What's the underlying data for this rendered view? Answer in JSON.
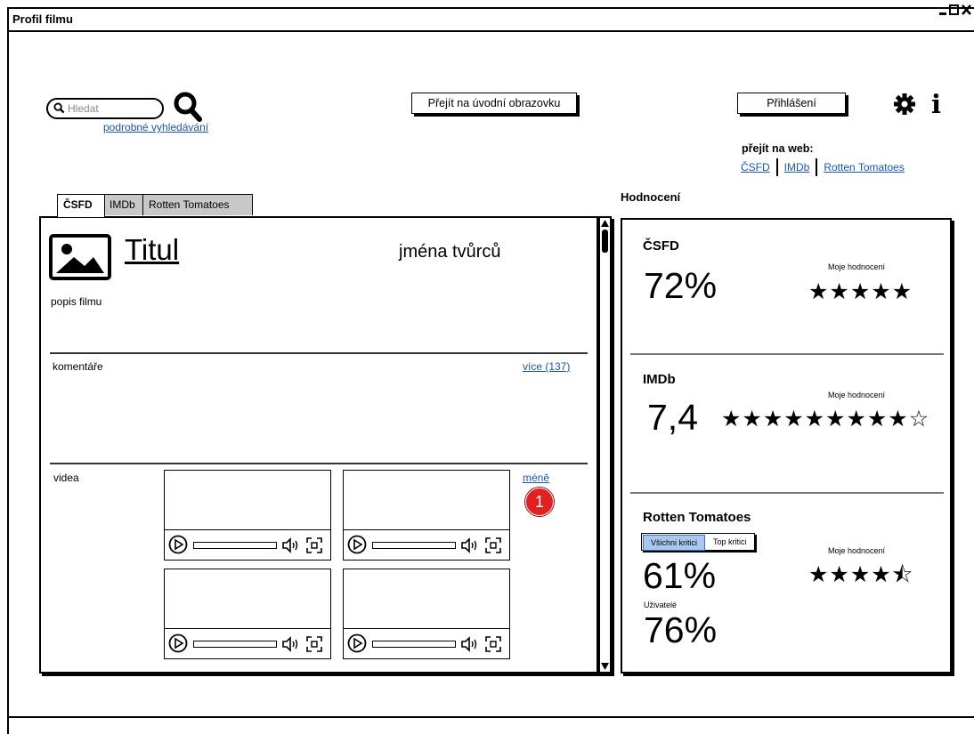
{
  "window": {
    "title": "Profil filmu",
    "controls": "– □ ✕",
    "corner_mark": "↘"
  },
  "header": {
    "search_placeholder": "Hledat",
    "advanced_search": "podrobné vyhledávání",
    "home_button": "Přejít na úvodní obrazovku",
    "login_button": "Přihlášení",
    "web_label": "přejít na web:",
    "web_links": [
      "ČSFD",
      "IMDb",
      "Rotten Tomatoes"
    ]
  },
  "tabs": [
    {
      "label": "ČSFD",
      "active": true
    },
    {
      "label": "IMDb",
      "active": false
    },
    {
      "label": "Rotten Tomatoes",
      "active": false
    }
  ],
  "film": {
    "title": "Titul",
    "creators": "jména tvůrců",
    "description": "popis filmu",
    "comments_label": "komentáře",
    "comments_more": "více (137)",
    "videos_label": "videa",
    "videos_less": "méně",
    "badge_count": "1",
    "video_count": 4
  },
  "ratings": {
    "heading": "Hodnocení",
    "my_rating_label": "Moje hodnocení",
    "csfd": {
      "name": "ČSFD",
      "score": "72%",
      "my_rating": 5,
      "max": 5,
      "stars": "★★★★★"
    },
    "imdb": {
      "name": "IMDb",
      "score": "7,4",
      "my_rating": 9,
      "max": 10,
      "stars": "★★★★★★★★★☆"
    },
    "rt": {
      "name": "Rotten Tomatoes",
      "toggle": [
        "Všichni kritici",
        "Top kritici"
      ],
      "critics_score": "61%",
      "users_label": "Uživatelé",
      "users_score": "76%",
      "my_rating": 4.5,
      "max": 5,
      "stars": "★★★★⯪"
    }
  },
  "colors": {
    "link": "#1a55b8",
    "badge": "#e32020",
    "toggle_active": "#a9c8f0"
  },
  "icons": [
    "search-icon",
    "gear-icon",
    "info-icon",
    "image-icon",
    "play-icon",
    "volume-icon",
    "fullscreen-icon",
    "scroll-up-icon",
    "scroll-down-icon"
  ]
}
